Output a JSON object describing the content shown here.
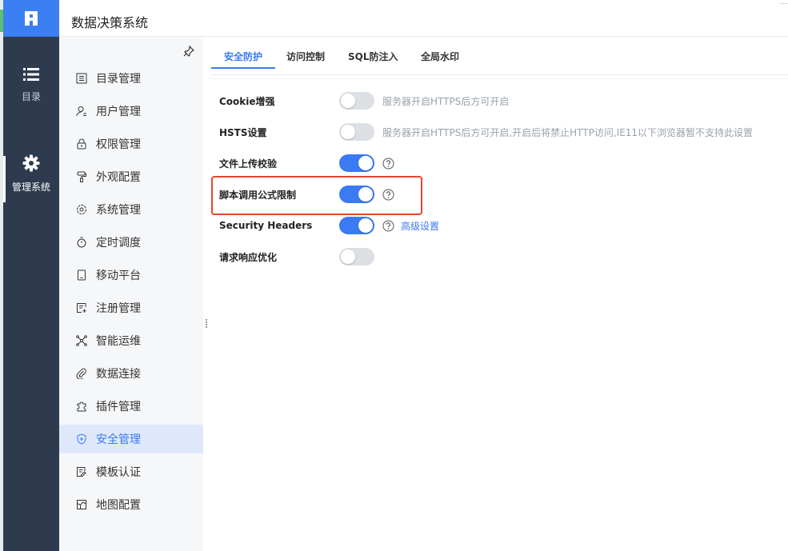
{
  "header": {
    "title": "数据决策系统"
  },
  "rail": {
    "items": [
      {
        "label": "目录",
        "icon": "list-icon"
      },
      {
        "label": "管理系统",
        "icon": "gear-icon"
      }
    ]
  },
  "sidebar": {
    "items": [
      {
        "label": "目录管理",
        "icon": "catalog-icon"
      },
      {
        "label": "用户管理",
        "icon": "user-icon"
      },
      {
        "label": "权限管理",
        "icon": "lock-icon"
      },
      {
        "label": "外观配置",
        "icon": "paint-roller-icon"
      },
      {
        "label": "系统管理",
        "icon": "settings-icon"
      },
      {
        "label": "定时调度",
        "icon": "stopwatch-icon"
      },
      {
        "label": "移动平台",
        "icon": "mobile-icon"
      },
      {
        "label": "注册管理",
        "icon": "register-icon"
      },
      {
        "label": "智能运维",
        "icon": "network-icon"
      },
      {
        "label": "数据连接",
        "icon": "paperclip-icon"
      },
      {
        "label": "插件管理",
        "icon": "puzzle-icon"
      },
      {
        "label": "安全管理",
        "icon": "shield-icon"
      },
      {
        "label": "模板认证",
        "icon": "template-icon"
      },
      {
        "label": "地图配置",
        "icon": "map-icon"
      }
    ],
    "active_index": 11
  },
  "tabs": [
    {
      "label": "安全防护"
    },
    {
      "label": "访问控制"
    },
    {
      "label": "SQL防注入"
    },
    {
      "label": "全局水印"
    }
  ],
  "settings": [
    {
      "label": "Cookie增强",
      "enabled": false,
      "hint": "服务器开启HTTPS后方可开启"
    },
    {
      "label": "HSTS设置",
      "enabled": false,
      "hint": "服务器开启HTTPS后方可开启,开启后将禁止HTTP访问,IE11以下浏览器暂不支持此设置"
    },
    {
      "label": "文件上传校验",
      "enabled": true,
      "help": true
    },
    {
      "label": "脚本调用公式限制",
      "enabled": true,
      "help": true
    },
    {
      "label": "Security Headers",
      "enabled": true,
      "help": true,
      "link": "高级设置"
    },
    {
      "label": "请求响应优化",
      "enabled": false
    }
  ],
  "colors": {
    "accent": "#3a7af2",
    "rail": "#2e3a4e",
    "highlight": "#e8442d"
  }
}
